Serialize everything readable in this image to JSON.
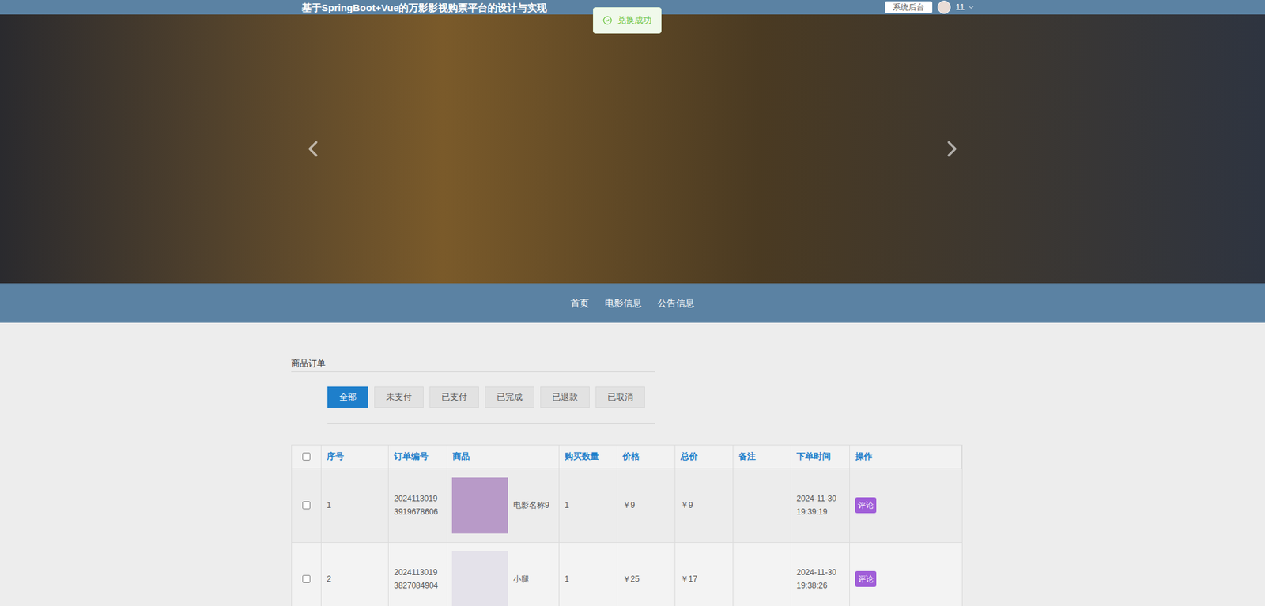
{
  "header": {
    "title": "基于SpringBoot+Vue的万影影视购票平台的设计与实现",
    "admin_button": "系统后台",
    "user": "11"
  },
  "toast": {
    "text": "兑换成功"
  },
  "nav": [
    {
      "label": "首页"
    },
    {
      "label": "电影信息"
    },
    {
      "label": "公告信息"
    }
  ],
  "section_title": "商品订单",
  "tabs": [
    {
      "label": "全部",
      "selected": true
    },
    {
      "label": "未支付",
      "selected": false
    },
    {
      "label": "已支付",
      "selected": false
    },
    {
      "label": "已完成",
      "selected": false
    },
    {
      "label": "已退款",
      "selected": false
    },
    {
      "label": "已取消",
      "selected": false
    }
  ],
  "table": {
    "select_all_checked": false,
    "columns": [
      "序号",
      "订单编号",
      "商品",
      "购买数量",
      "价格",
      "总价",
      "备注",
      "下单时间",
      "操作"
    ],
    "rows": [
      {
        "checked": false,
        "index": "1",
        "order_no": "20241130193919678606",
        "product": "电影名称9",
        "image_color": "#b89ac8",
        "qty": "1",
        "price": "￥9",
        "total": "￥9",
        "remark": "",
        "time": "2024-11-30 19:39:19",
        "action": "评论"
      },
      {
        "checked": false,
        "index": "2",
        "order_no": "20241130193827084904",
        "product": "小腿",
        "image_color": "#e4e2ea",
        "qty": "1",
        "price": "￥25",
        "total": "￥17",
        "remark": "",
        "time": "2024-11-30 19:38:26",
        "action": "评论"
      }
    ]
  }
}
